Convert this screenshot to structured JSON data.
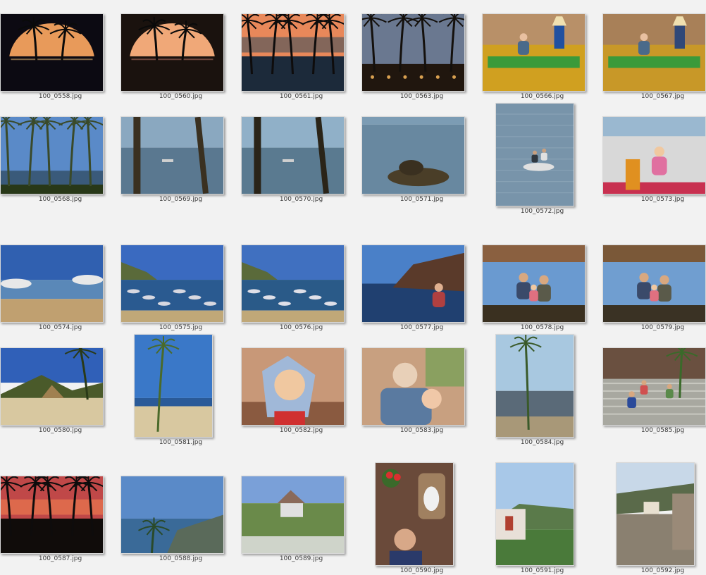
{
  "window": {
    "view": "thumbnail-grid"
  },
  "thumbnails": [
    {
      "filename": "100_0558.jpg",
      "orientation": "landscape",
      "scene": "sunset-arch",
      "colors": {
        "sky": "#e89a5a",
        "ground": "#0c0a12",
        "accent": "#f4c27a"
      }
    },
    {
      "filename": "100_0560.jpg",
      "orientation": "landscape",
      "scene": "sunset-arch",
      "colors": {
        "sky": "#f0a878",
        "ground": "#1a120e",
        "accent": "#c07a6a"
      }
    },
    {
      "filename": "100_0561.jpg",
      "orientation": "landscape",
      "scene": "sunset-palms",
      "colors": {
        "sky": "#e8885a",
        "ground": "#1c2a3a",
        "accent": "#40505a"
      }
    },
    {
      "filename": "100_0563.jpg",
      "orientation": "landscape",
      "scene": "dusk-palms",
      "colors": {
        "sky": "#6a7890",
        "ground": "#20160e",
        "accent": "#d8a050"
      }
    },
    {
      "filename": "100_0566.jpg",
      "orientation": "landscape",
      "scene": "room-couch",
      "colors": {
        "sky": "#b89068",
        "ground": "#d0a020",
        "accent": "#2050a0"
      }
    },
    {
      "filename": "100_0567.jpg",
      "orientation": "landscape",
      "scene": "room-couch",
      "colors": {
        "sky": "#a88058",
        "ground": "#c89828",
        "accent": "#304878"
      }
    },
    {
      "filename": "100_0568.jpg",
      "orientation": "landscape",
      "scene": "beach-palms",
      "colors": {
        "sky": "#5a8ac8",
        "ground": "#283818",
        "accent": "#3a4a2a"
      }
    },
    {
      "filename": "100_0569.jpg",
      "orientation": "landscape",
      "scene": "sea-trunks",
      "colors": {
        "sky": "#8aa8c0",
        "ground": "#5a7890",
        "accent": "#3a3020"
      }
    },
    {
      "filename": "100_0570.jpg",
      "orientation": "landscape",
      "scene": "sea-trunks",
      "colors": {
        "sky": "#90b0c8",
        "ground": "#5a7a90",
        "accent": "#2a2418"
      }
    },
    {
      "filename": "100_0571.jpg",
      "orientation": "landscape",
      "scene": "sea-rock",
      "colors": {
        "sky": "#7c9cb4",
        "ground": "#6888a0",
        "accent": "#4a3e28"
      }
    },
    {
      "filename": "100_0572.jpg",
      "orientation": "portrait",
      "scene": "sea-boat",
      "colors": {
        "sky": "#8aa4b8",
        "ground": "#7894aa",
        "accent": "#e0e0e0"
      }
    },
    {
      "filename": "100_0573.jpg",
      "orientation": "landscape",
      "scene": "cafe-girl",
      "colors": {
        "sky": "#9ab8d0",
        "ground": "#d8d8d8",
        "accent": "#e09020"
      }
    },
    {
      "filename": "100_0574.jpg",
      "orientation": "landscape",
      "scene": "beach-umbrellas",
      "colors": {
        "sky": "#3060b0",
        "ground": "#c0a070",
        "accent": "#e8e8e8"
      }
    },
    {
      "filename": "100_0575.jpg",
      "orientation": "landscape",
      "scene": "bay-boats",
      "colors": {
        "sky": "#3a6ac0",
        "ground": "#2a5a90",
        "accent": "#d8d8e0"
      }
    },
    {
      "filename": "100_0576.jpg",
      "orientation": "landscape",
      "scene": "bay-boats",
      "colors": {
        "sky": "#4070c0",
        "ground": "#2a5a88",
        "accent": "#e0e0e8"
      }
    },
    {
      "filename": "100_0577.jpg",
      "orientation": "landscape",
      "scene": "bay-family",
      "colors": {
        "sky": "#4a80c8",
        "ground": "#204070",
        "accent": "#5a3a2a"
      }
    },
    {
      "filename": "100_0578.jpg",
      "orientation": "landscape",
      "scene": "palapa-family",
      "colors": {
        "sky": "#6a9ad0",
        "ground": "#3a3020",
        "accent": "#8a6040"
      }
    },
    {
      "filename": "100_0579.jpg",
      "orientation": "landscape",
      "scene": "palapa-family",
      "colors": {
        "sky": "#709ed0",
        "ground": "#3a3224",
        "accent": "#7a5838"
      }
    },
    {
      "filename": "100_0580.jpg",
      "orientation": "landscape",
      "scene": "beach-hut",
      "colors": {
        "sky": "#3060b8",
        "ground": "#d8c8a0",
        "accent": "#4a5a2a"
      }
    },
    {
      "filename": "100_0581.jpg",
      "orientation": "portrait",
      "scene": "beach-palm",
      "colors": {
        "sky": "#3a78c8",
        "ground": "#d8c8a0",
        "accent": "#4a6a2a"
      }
    },
    {
      "filename": "100_0582.jpg",
      "orientation": "landscape",
      "scene": "child-hat",
      "colors": {
        "sky": "#c89878",
        "ground": "#8a5a40",
        "accent": "#a0b8d8"
      }
    },
    {
      "filename": "100_0583.jpg",
      "orientation": "landscape",
      "scene": "man-child",
      "colors": {
        "sky": "#8aa060",
        "ground": "#5a7aa0",
        "accent": "#e8d0b8"
      }
    },
    {
      "filename": "100_0584.jpg",
      "orientation": "portrait",
      "scene": "shore-palm",
      "colors": {
        "sky": "#a8c8e0",
        "ground": "#5a6a78",
        "accent": "#3a5a2a"
      }
    },
    {
      "filename": "100_0585.jpg",
      "orientation": "landscape",
      "scene": "steps-people",
      "colors": {
        "sky": "#c8c8b8",
        "ground": "#a8a8a0",
        "accent": "#3a6a2a"
      }
    },
    {
      "filename": "100_0587.jpg",
      "orientation": "landscape",
      "scene": "sunset-palms",
      "colors": {
        "sky": "#c04848",
        "ground": "#100c0a",
        "accent": "#f08050"
      }
    },
    {
      "filename": "100_0588.jpg",
      "orientation": "landscape",
      "scene": "coast-view",
      "colors": {
        "sky": "#5a8ac8",
        "ground": "#3a6a98",
        "accent": "#2a4a2a"
      }
    },
    {
      "filename": "100_0589.jpg",
      "orientation": "landscape",
      "scene": "gazebo-garden",
      "colors": {
        "sky": "#7aa0d8",
        "ground": "#6a8a4a",
        "accent": "#e0e0e0"
      }
    },
    {
      "filename": "100_0590.jpg",
      "orientation": "portrait",
      "scene": "shrine-woman",
      "colors": {
        "sky": "#6a4a3a",
        "ground": "#2a3a6a",
        "accent": "#d83030"
      }
    },
    {
      "filename": "100_0591.jpg",
      "orientation": "portrait",
      "scene": "village-house",
      "colors": {
        "sky": "#a8c8e8",
        "ground": "#4a7a3a",
        "accent": "#e8e0d8"
      }
    },
    {
      "filename": "100_0592.jpg",
      "orientation": "portrait",
      "scene": "village-street",
      "colors": {
        "sky": "#c8d8e8",
        "ground": "#8a8070",
        "accent": "#5a6a4a"
      }
    }
  ]
}
